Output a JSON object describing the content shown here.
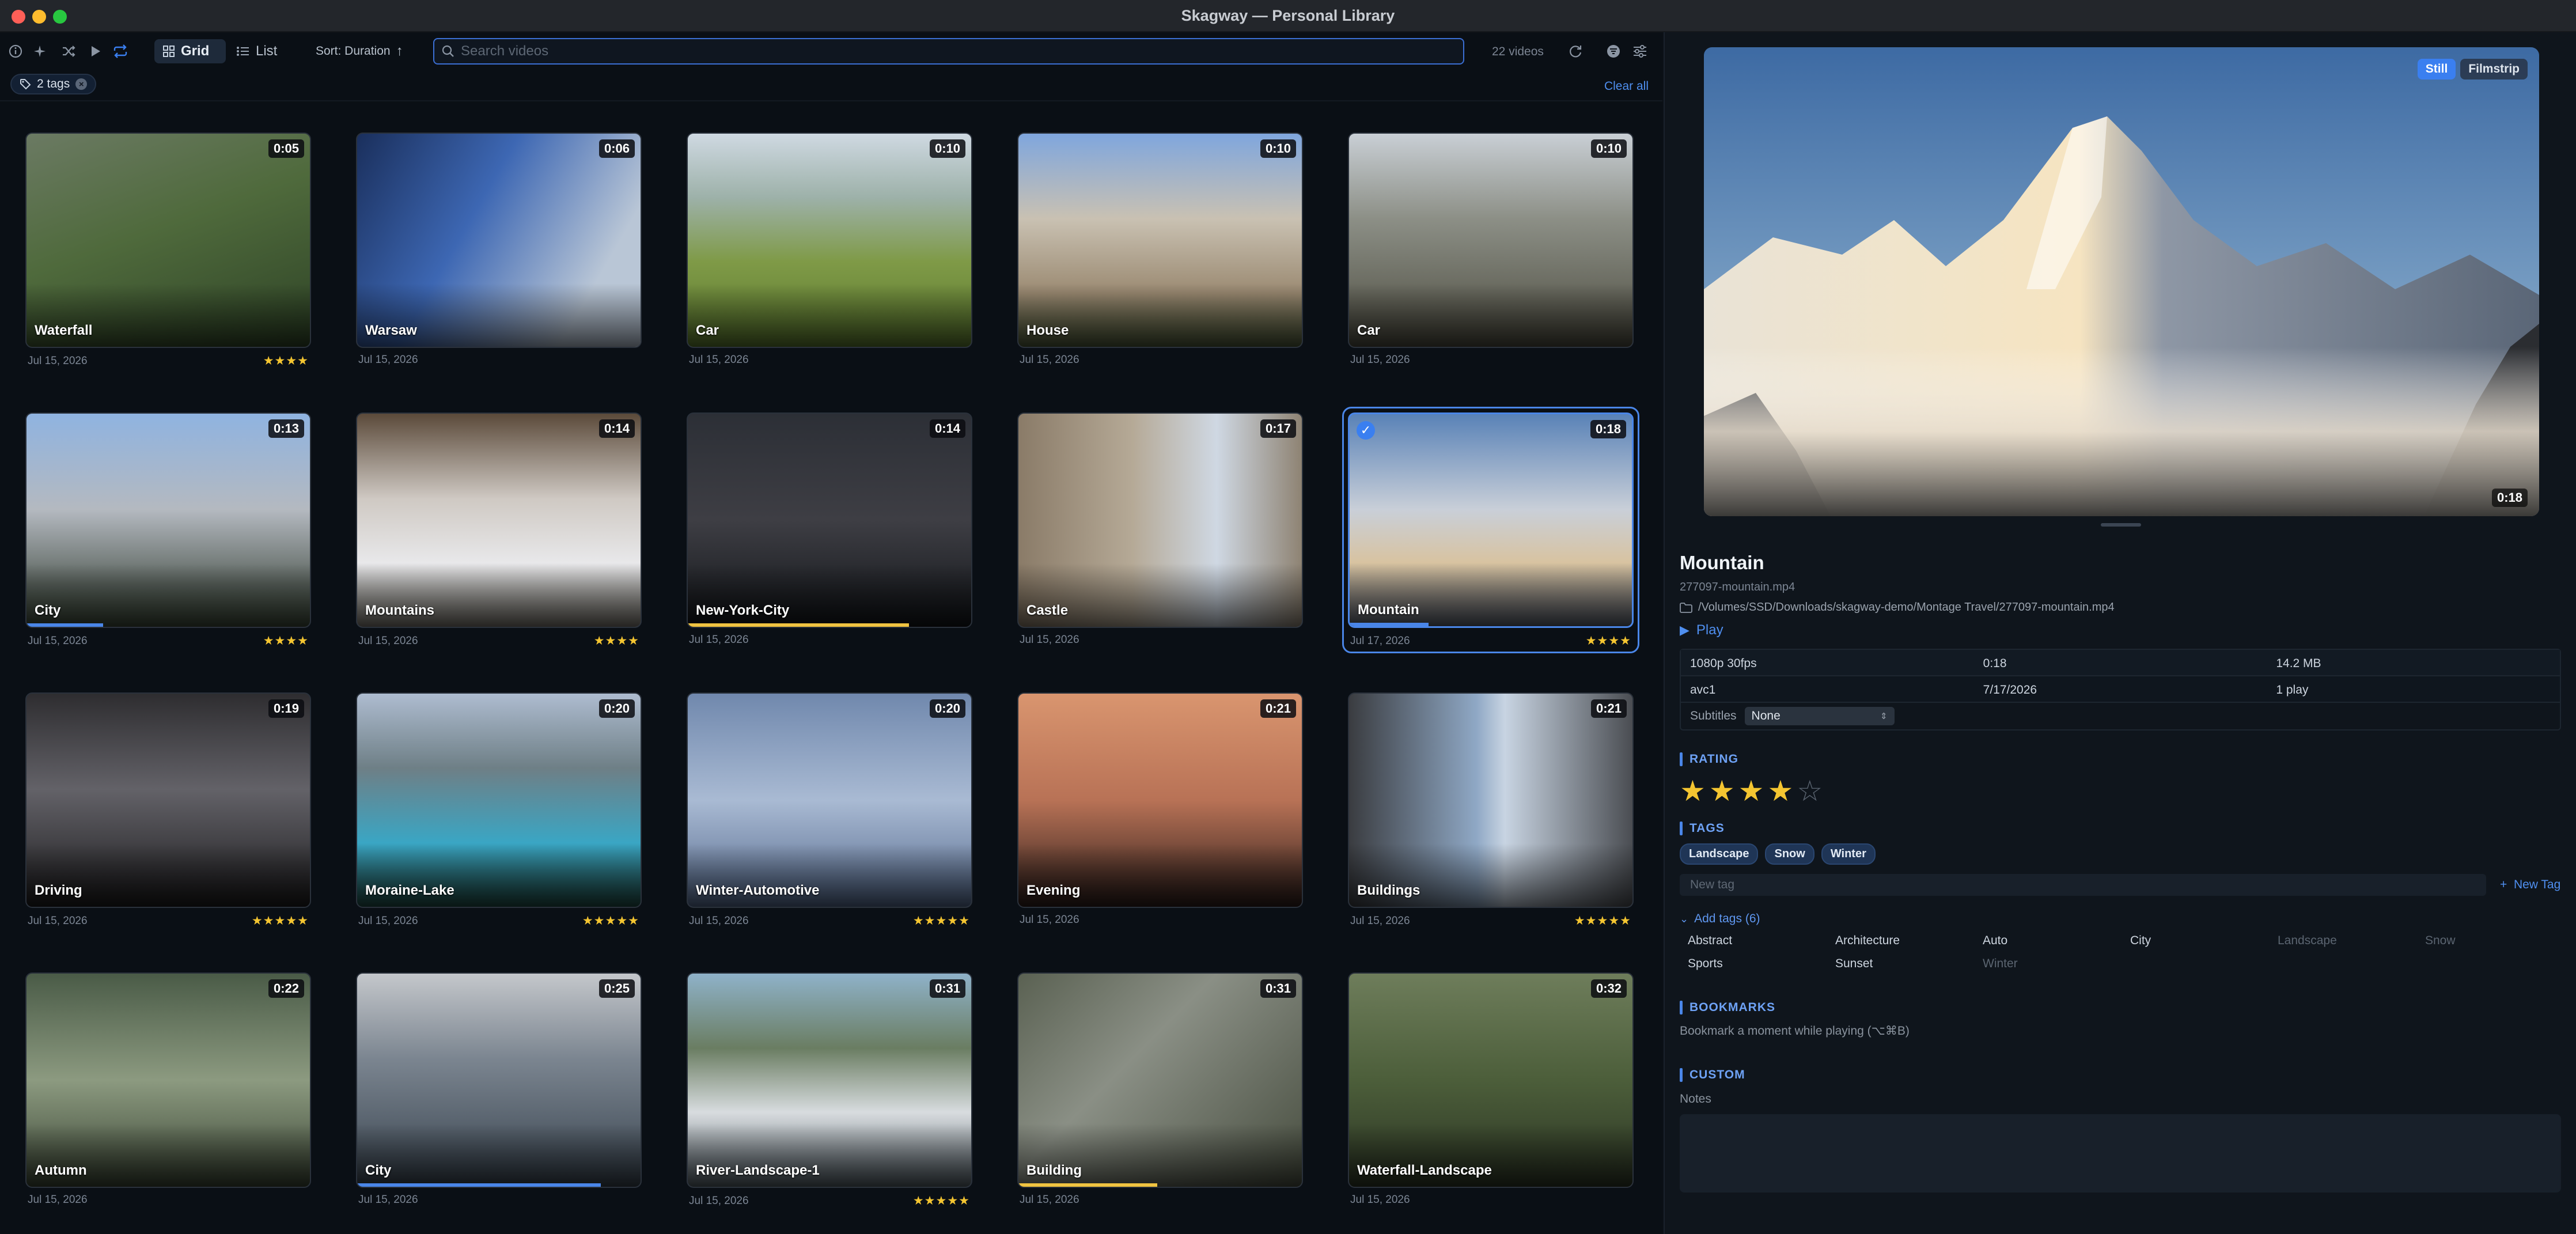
{
  "window": {
    "title": "Skagway — Personal Library"
  },
  "toolbar": {
    "grid_label": "Grid",
    "list_label": "List",
    "sort_label": "Sort: Duration",
    "search_placeholder": "Search videos",
    "count": "22 videos"
  },
  "filters": {
    "tag_chip": "2 tags",
    "clear_all": "Clear all"
  },
  "videos": [
    {
      "name": "Waterfall",
      "duration": "0:05",
      "date": "Jul 15, 2026",
      "stars": "★★★★",
      "progress": 0
    },
    {
      "name": "Warsaw",
      "duration": "0:06",
      "date": "Jul 15, 2026",
      "stars": "",
      "progress": 0
    },
    {
      "name": "Car",
      "duration": "0:10",
      "date": "Jul 15, 2026",
      "stars": "",
      "progress": 0
    },
    {
      "name": "House",
      "duration": "0:10",
      "date": "Jul 15, 2026",
      "stars": "",
      "progress": 0
    },
    {
      "name": "Car",
      "duration": "0:10",
      "date": "Jul 15, 2026",
      "stars": "",
      "progress": 0
    },
    {
      "name": "City",
      "duration": "0:13",
      "date": "Jul 15, 2026",
      "stars": "★★★★",
      "progress": 0.27
    },
    {
      "name": "Mountains",
      "duration": "0:14",
      "date": "Jul 15, 2026",
      "stars": "★★★★",
      "progress": 0
    },
    {
      "name": "New-York-City",
      "duration": "0:14",
      "date": "Jul 15, 2026",
      "stars": "",
      "progress": 0.78
    },
    {
      "name": "Castle",
      "duration": "0:17",
      "date": "Jul 15, 2026",
      "stars": "",
      "progress": 0
    },
    {
      "name": "Mountain",
      "duration": "0:18",
      "date": "Jul 17, 2026",
      "stars": "★★★★",
      "progress": 0.28,
      "selected": true
    },
    {
      "name": "Driving",
      "duration": "0:19",
      "date": "Jul 15, 2026",
      "stars": "★★★★★",
      "progress": 0
    },
    {
      "name": "Moraine-Lake",
      "duration": "0:20",
      "date": "Jul 15, 2026",
      "stars": "★★★★★",
      "progress": 0
    },
    {
      "name": "Winter-Automotive",
      "duration": "0:20",
      "date": "Jul 15, 2026",
      "stars": "★★★★★",
      "progress": 0
    },
    {
      "name": "Evening",
      "duration": "0:21",
      "date": "Jul 15, 2026",
      "stars": "",
      "progress": 0
    },
    {
      "name": "Buildings",
      "duration": "0:21",
      "date": "Jul 15, 2026",
      "stars": "★★★★★",
      "progress": 0
    },
    {
      "name": "Autumn",
      "duration": "0:22",
      "date": "Jul 15, 2026",
      "stars": "",
      "progress": 0
    },
    {
      "name": "City",
      "duration": "0:25",
      "date": "Jul 15, 2026",
      "stars": "",
      "progress": 0.86
    },
    {
      "name": "River-Landscape-1",
      "duration": "0:31",
      "date": "Jul 15, 2026",
      "stars": "★★★★★",
      "progress": 0
    },
    {
      "name": "Building",
      "duration": "0:31",
      "date": "Jul 15, 2026",
      "stars": "",
      "progress": 0.49
    },
    {
      "name": "Waterfall-Landscape",
      "duration": "0:32",
      "date": "Jul 15, 2026",
      "stars": "",
      "progress": 0
    }
  ],
  "preview": {
    "still_label": "Still",
    "filmstrip_label": "Filmstrip",
    "duration": "0:18"
  },
  "details": {
    "title": "Mountain",
    "filename": "277097-mountain.mp4",
    "path": "/Volumes/SSD/Downloads/skagway-demo/Montage Travel/277097-mountain.mp4",
    "play_label": "Play",
    "props": {
      "resolution": "1080p 30fps",
      "duration": "0:18",
      "size": "14.2 MB",
      "codec": "avc1",
      "date": "7/17/2026",
      "plays": "1 play"
    },
    "subtitles_label": "Subtitles",
    "subtitles_value": "None",
    "rating_label": "RATING",
    "rating": 4,
    "tags_label": "TAGS",
    "tags": [
      "Landscape",
      "Snow",
      "Winter"
    ],
    "newtag_placeholder": "New tag",
    "newtag_button": "New Tag",
    "add_tags_label": "Add tags (6)",
    "available_tags": [
      {
        "name": "Abstract",
        "dim": false
      },
      {
        "name": "Architecture",
        "dim": false
      },
      {
        "name": "Auto",
        "dim": false
      },
      {
        "name": "City",
        "dim": false
      },
      {
        "name": "Landscape",
        "dim": true
      },
      {
        "name": "Snow",
        "dim": true
      },
      {
        "name": "Sports",
        "dim": false
      },
      {
        "name": "Sunset",
        "dim": false
      },
      {
        "name": "Winter",
        "dim": true
      }
    ],
    "bookmarks_label": "BOOKMARKS",
    "bookmarks_hint": "Bookmark a moment while playing (⌥⌘B)",
    "custom_label": "CUSTOM",
    "notes_label": "Notes"
  },
  "colors": {
    "accent": "#3a7ff0",
    "star": "#f4c531",
    "progress_blue": "#4a86e8",
    "progress_yellow": "#f0c341"
  }
}
